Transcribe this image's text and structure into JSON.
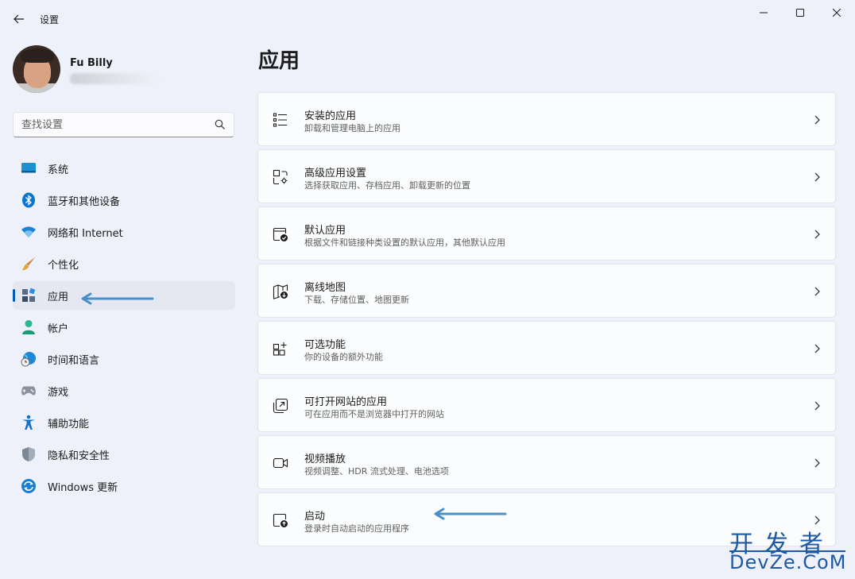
{
  "window": {
    "title": "设置"
  },
  "profile": {
    "name": "Fu Billy"
  },
  "search": {
    "placeholder": "查找设置"
  },
  "nav": {
    "items": [
      {
        "label": "系统",
        "icon": "monitor-icon"
      },
      {
        "label": "蓝牙和其他设备",
        "icon": "bluetooth-icon"
      },
      {
        "label": "网络和 Internet",
        "icon": "wifi-icon"
      },
      {
        "label": "个性化",
        "icon": "brush-icon"
      },
      {
        "label": "应用",
        "icon": "apps-icon",
        "active": true
      },
      {
        "label": "帐户",
        "icon": "person-icon"
      },
      {
        "label": "时间和语言",
        "icon": "globe-clock-icon"
      },
      {
        "label": "游戏",
        "icon": "gamepad-icon"
      },
      {
        "label": "辅助功能",
        "icon": "accessibility-icon"
      },
      {
        "label": "隐私和安全性",
        "icon": "shield-icon"
      },
      {
        "label": "Windows 更新",
        "icon": "update-icon"
      }
    ]
  },
  "main": {
    "title": "应用",
    "cards": [
      {
        "title": "安装的应用",
        "subtitle": "卸载和管理电脑上的应用",
        "icon": "list-icon"
      },
      {
        "title": "高级应用设置",
        "subtitle": "选择获取应用、存档应用、卸载更新的位置",
        "icon": "app-settings-icon"
      },
      {
        "title": "默认应用",
        "subtitle": "根据文件和链接种类设置的默认应用，其他默认应用",
        "icon": "default-app-icon"
      },
      {
        "title": "离线地图",
        "subtitle": "下载、存储位置、地图更新",
        "icon": "map-download-icon"
      },
      {
        "title": "可选功能",
        "subtitle": "你的设备的额外功能",
        "icon": "add-feature-icon"
      },
      {
        "title": "可打开网站的应用",
        "subtitle": "可在应用而不是浏览器中打开的网站",
        "icon": "open-link-icon"
      },
      {
        "title": "视频播放",
        "subtitle": "视频调整、HDR 流式处理、电池选项",
        "icon": "video-icon"
      },
      {
        "title": "启动",
        "subtitle": "登录时自动启动的应用程序",
        "icon": "startup-icon"
      }
    ]
  },
  "watermark": {
    "line1": "开发者",
    "line2": "DevZe.CoM"
  },
  "colors": {
    "accent": "#005fb8",
    "background": "#eef1f9",
    "card": "#fbfcfd",
    "arrow": "#4a90c8",
    "watermark": "#1e5aa3"
  }
}
